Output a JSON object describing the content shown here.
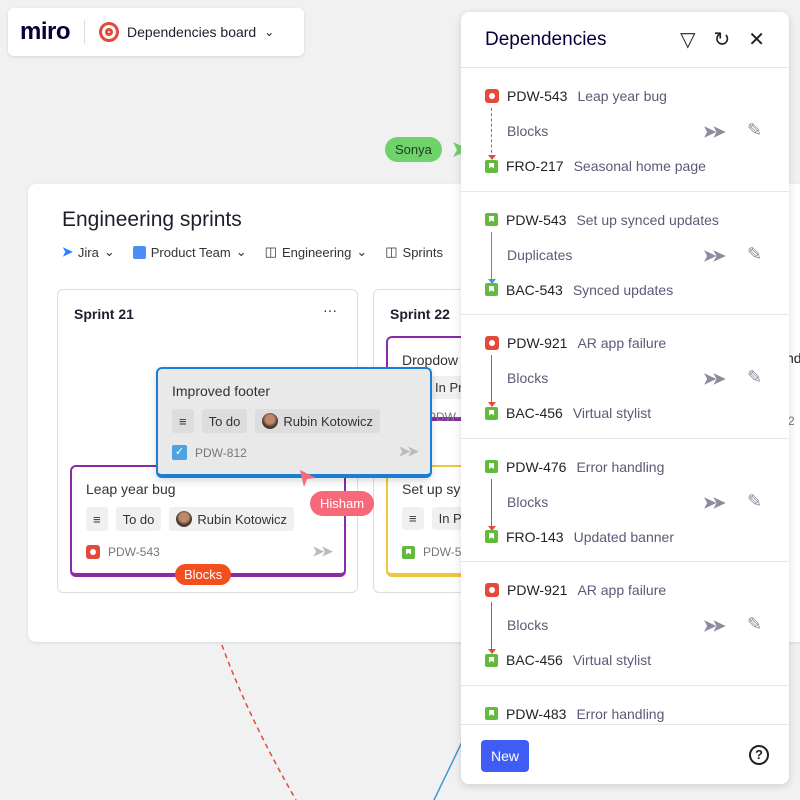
{
  "topbar": {
    "logo": "miro",
    "board_name": "Dependencies board"
  },
  "board": {
    "title": "Engineering sprints",
    "filters": [
      {
        "label": "Jira"
      },
      {
        "label": "Product Team"
      },
      {
        "label": "Engineering"
      },
      {
        "label": "Sprints"
      }
    ],
    "columns": [
      {
        "title": "Sprint 21",
        "menu": "···"
      },
      {
        "title": "Sprint 22"
      }
    ],
    "cards": {
      "leap": {
        "title": "Leap year bug",
        "status": "To do",
        "assignee": "Rubin Kotowicz",
        "key": "PDW-543"
      },
      "footer": {
        "title": "Improved footer",
        "status": "To do",
        "assignee": "Rubin Kotowicz",
        "key": "PDW-812"
      },
      "dropdown": {
        "title": "Dropdow",
        "status": "In Pr",
        "key": "PDW-1"
      },
      "synced": {
        "title": "Set up sy",
        "status": "In Pr",
        "key": "PDW-5"
      },
      "right_partial": {
        "title": "nd",
        "key": "2"
      }
    },
    "blocks_tag": "Blocks"
  },
  "cursors": [
    {
      "name": "Sonya",
      "color": "#6dd36a"
    },
    {
      "name": "Hisham",
      "color": "#f5697a"
    }
  ],
  "panel": {
    "title": "Dependencies",
    "deps": [
      {
        "from_key": "PDW-543",
        "from_title": "Leap year bug",
        "from_type": "bug",
        "relation": "Blocks",
        "to_key": "FRO-217",
        "to_title": "Seasonal home page",
        "to_type": "story",
        "line_color": "#e5493a",
        "dashed": true
      },
      {
        "from_key": "PDW-543",
        "from_title": "Set up synced updates",
        "from_type": "story",
        "relation": "Duplicates",
        "to_key": "BAC-543",
        "to_title": "Synced updates",
        "to_type": "story",
        "line_color": "#3b9ad9",
        "dashed": false
      },
      {
        "from_key": "PDW-921",
        "from_title": "AR app failure",
        "from_type": "bug",
        "relation": "Blocks",
        "to_key": "BAC-456",
        "to_title": "Virtual stylist",
        "to_type": "story",
        "line_color": "#e5493a",
        "dashed": false
      },
      {
        "from_key": "PDW-476",
        "from_title": "Error handling",
        "from_type": "story",
        "relation": "Blocks",
        "to_key": "FRO-143",
        "to_title": "Updated banner",
        "to_type": "story",
        "line_color": "#e5493a",
        "dashed": false
      },
      {
        "from_key": "PDW-921",
        "from_title": "AR app failure",
        "from_type": "bug",
        "relation": "Blocks",
        "to_key": "BAC-456",
        "to_title": "Virtual stylist",
        "to_type": "story",
        "line_color": "#e5493a",
        "dashed": false
      },
      {
        "from_key": "PDW-483",
        "from_title": "Error handling",
        "from_type": "story"
      }
    ],
    "new_button": "New",
    "help": "?"
  }
}
